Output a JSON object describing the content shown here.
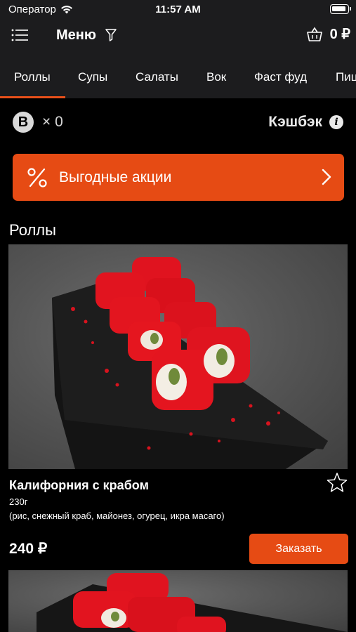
{
  "status_bar": {
    "carrier": "Оператор",
    "time": "11:57 AM"
  },
  "nav": {
    "title": "Меню",
    "cart_total": "0 ₽"
  },
  "tabs": [
    "Роллы",
    "Супы",
    "Салаты",
    "Вок",
    "Фаст фуд",
    "Пицца"
  ],
  "active_tab": "Роллы",
  "cashback": {
    "badge": "B",
    "count": "× 0",
    "label": "Кэшбэк",
    "info": "i"
  },
  "promo": {
    "label": "Выгодные акции"
  },
  "section": {
    "title": "Роллы"
  },
  "products": [
    {
      "name": "Калифорния с крабом",
      "weight": "230г",
      "ingredients": "(рис, снежный краб, майонез, огурец, икра масаго)",
      "price": "240 ₽",
      "order_label": "Заказать"
    }
  ],
  "colors": {
    "accent": "#e64b14",
    "bar_background": "#1c1c1e",
    "background": "#000000"
  },
  "icons": [
    "wifi-icon",
    "battery-icon",
    "menu-list-icon",
    "filter-icon",
    "basket-icon",
    "info-icon",
    "percent-icon",
    "chevron-right-icon",
    "star-outline-icon"
  ]
}
